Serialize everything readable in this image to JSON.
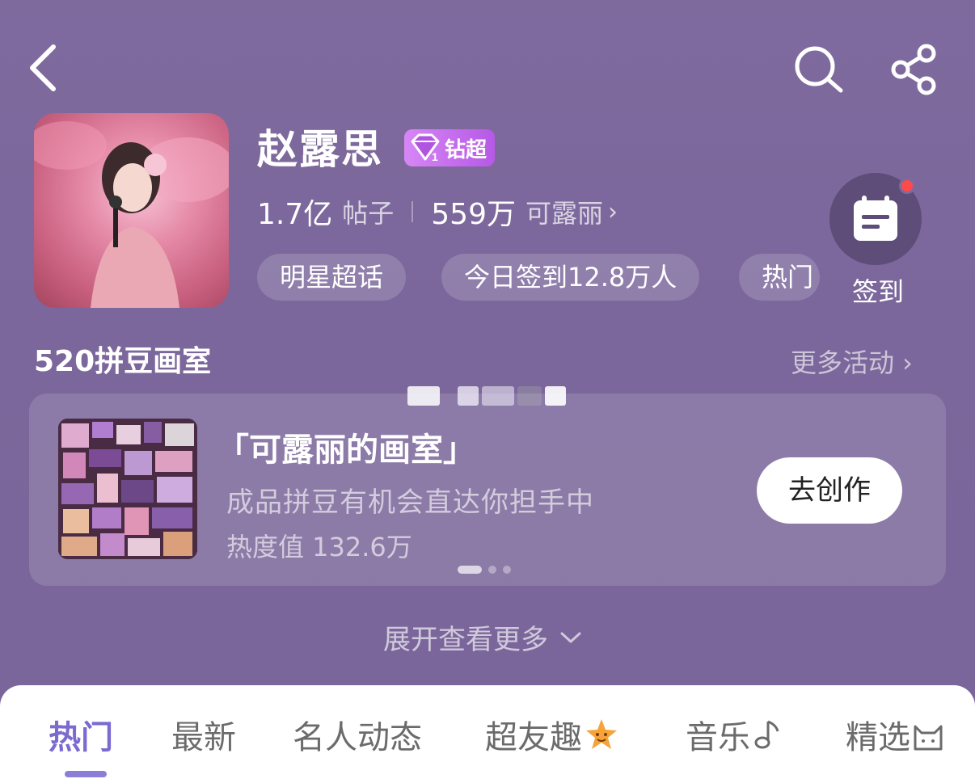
{
  "header": {
    "back_icon": "chevron-left-icon",
    "search_icon": "search-icon",
    "share_icon": "share-icon"
  },
  "profile": {
    "title": "赵露思",
    "level_number": "1",
    "level_label": "钻超",
    "posts_count": "1.7亿",
    "posts_unit": "帖子",
    "fans_count": "559万",
    "fans_unit": "可露丽",
    "fans_chevron": "›",
    "tags": [
      "明星超话",
      "今日签到12.8万人",
      "热门"
    ]
  },
  "checkin": {
    "label": "签到",
    "has_notification": true,
    "icon": "calendar-icon"
  },
  "activity": {
    "section_title": "520拼豆画室",
    "more_label": "更多活动 ›",
    "card": {
      "name": "「可露丽的画室」",
      "description": "成品拼豆有机会直达你担手中",
      "heat": "热度值 132.6万",
      "button_label": "去创作"
    },
    "pager": {
      "count": 3,
      "active": 0
    }
  },
  "expand_label": "展开查看更多",
  "tabs": [
    {
      "label": "热门",
      "active": true
    },
    {
      "label": "最新",
      "active": false
    },
    {
      "label": "名人动态",
      "active": false
    },
    {
      "label": "超友趣",
      "active": false,
      "icon": "star-face-icon"
    },
    {
      "label": "音乐",
      "active": false,
      "icon": "music-note-icon"
    },
    {
      "label": "精选",
      "active": false,
      "icon": "cat-icon"
    }
  ],
  "colors": {
    "background": "#7b679b",
    "accent": "#7b6ad0",
    "badge": "#c06ae9",
    "notification": "#ff4a4a"
  }
}
